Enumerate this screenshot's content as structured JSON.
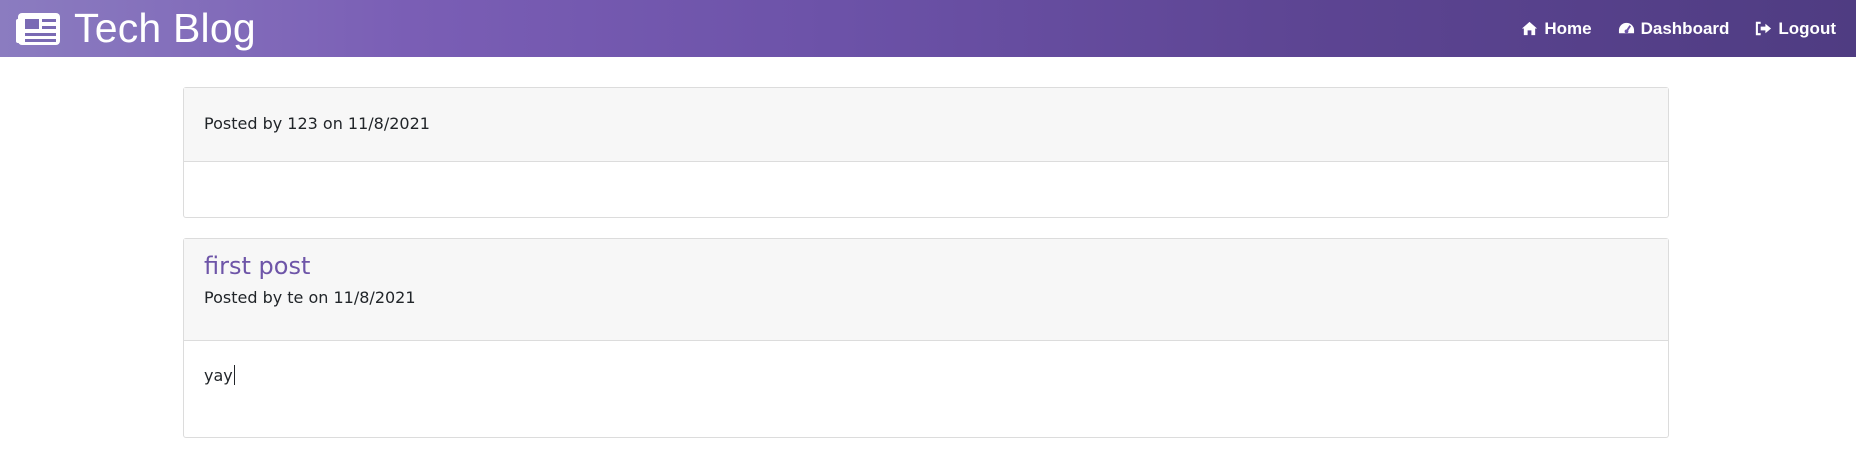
{
  "brand": {
    "title": "Tech Blog",
    "icon": "newspaper-icon"
  },
  "nav": {
    "home_label": "Home",
    "home_icon": "home-icon",
    "dashboard_label": "Dashboard",
    "dashboard_icon": "dashboard-icon",
    "logout_label": "Logout",
    "logout_icon": "sign-out-icon"
  },
  "posts": [
    {
      "title": "",
      "meta": "Posted by 123 on 11/8/2021",
      "body": ""
    },
    {
      "title": "first post",
      "meta": "Posted by te on 11/8/2021",
      "body": "yay"
    }
  ],
  "colors": {
    "navbar_gradient_start": "#8b7cc0",
    "navbar_gradient_end": "#4f3c82",
    "post_title": "#6e55a8",
    "card_header_bg": "#f7f7f7"
  }
}
